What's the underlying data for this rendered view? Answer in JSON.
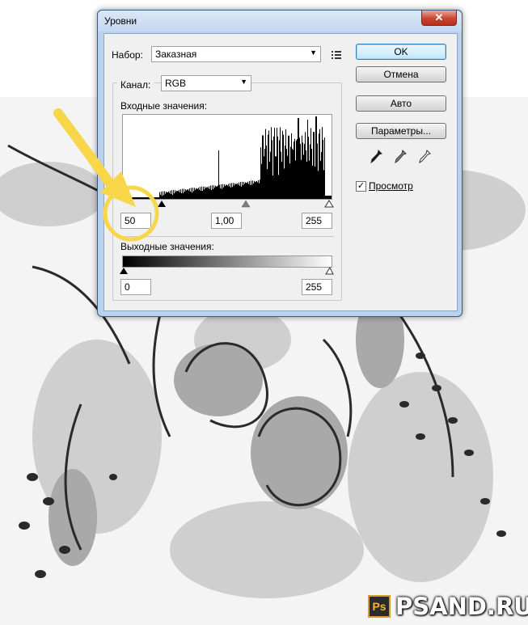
{
  "window": {
    "title": "Уровни",
    "close_glyph": "✕"
  },
  "preset": {
    "label": "Набор:",
    "value": "Заказная"
  },
  "channel": {
    "label": "Канал:",
    "value": "RGB"
  },
  "input": {
    "label": "Входные значения:",
    "black": "50",
    "gamma": "1,00",
    "white": "255"
  },
  "output": {
    "label": "Выходные значения:",
    "black": "0",
    "white": "255"
  },
  "buttons": {
    "ok": "OK",
    "cancel": "Отмена",
    "auto": "Авто",
    "options": "Параметры..."
  },
  "preview": {
    "label": "Просмотр",
    "checked": true
  },
  "eyedroppers": [
    "black-point-eyedropper-icon",
    "gray-point-eyedropper-icon",
    "white-point-eyedropper-icon"
  ],
  "watermark": {
    "ps": "Ps",
    "text": "PSAND.RU"
  },
  "colors": {
    "annotation": "#f7d64a",
    "title_bar": "#c4d8ef",
    "close": "#c8452f"
  }
}
